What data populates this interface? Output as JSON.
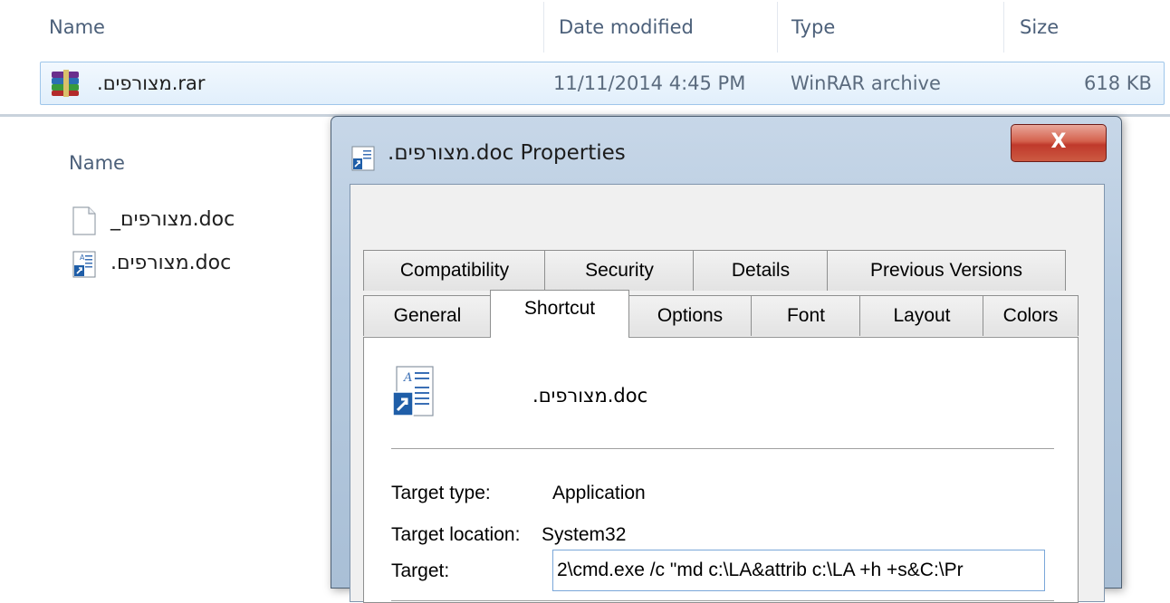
{
  "top_explorer": {
    "columns": {
      "name": "Name",
      "date": "Date modified",
      "type": "Type",
      "size": "Size"
    },
    "row": {
      "name": ".מצורפים.rar",
      "date": "11/11/2014 4:45 PM",
      "type": "WinRAR archive",
      "size": "618 KB",
      "icon": "winrar-archive-icon"
    }
  },
  "lower_explorer": {
    "column_name": "Name",
    "files": [
      {
        "name": "_מצורפים.doc",
        "icon": "blank-file-icon"
      },
      {
        "name": ".מצורפים.doc",
        "icon": "doc-shortcut-icon"
      }
    ]
  },
  "dialog": {
    "title": ".מצורפים.doc Properties",
    "close_label": "X",
    "tabs_row1": [
      "Compatibility",
      "Security",
      "Details",
      "Previous Versions"
    ],
    "tabs_row2": [
      "General",
      "Shortcut",
      "Options",
      "Font",
      "Layout",
      "Colors"
    ],
    "active_tab": "Shortcut",
    "shortcut": {
      "doc_name": ".מצורפים.doc",
      "target_type_label": "Target type:",
      "target_type": "Application",
      "target_location_label": "Target location:",
      "target_location": "System32",
      "target_label": "Target:",
      "target_value": "2\\cmd.exe /c \"md c:\\LA&attrib c:\\LA +h +s&C:\\Pr"
    }
  },
  "colors": {
    "selection_border": "#9fc6ea",
    "close_red": "#c0392b",
    "dialog_frame": "#b6cadf"
  }
}
